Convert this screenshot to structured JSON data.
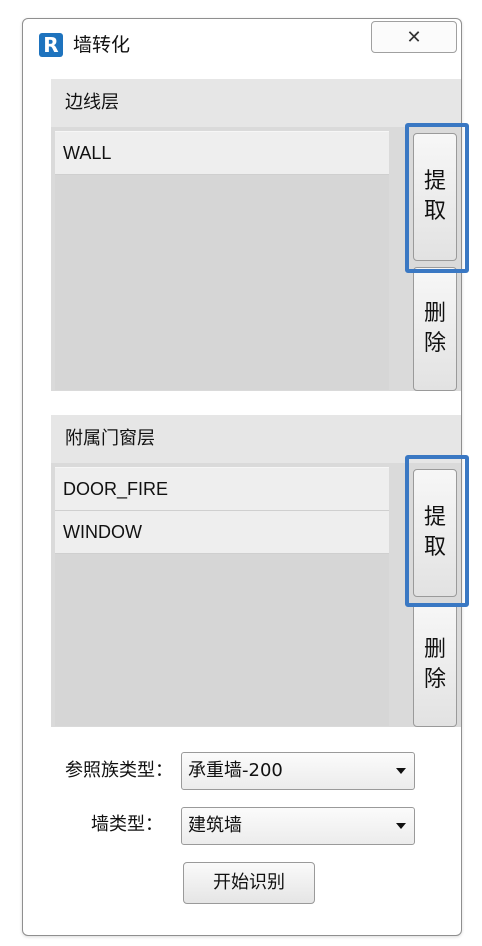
{
  "window": {
    "title": "墙转化",
    "app_icon_letter": "R",
    "close_symbol": "✕"
  },
  "edge_layer": {
    "label": "边线层",
    "items": [
      "WALL"
    ],
    "extract_button": [
      "提",
      "取"
    ],
    "delete_button": [
      "删",
      "除"
    ]
  },
  "opening_layer": {
    "label": "附属门窗层",
    "items": [
      "DOOR_FIRE",
      "WINDOW"
    ],
    "extract_button": [
      "提",
      "取"
    ],
    "delete_button": [
      "删",
      "除"
    ]
  },
  "form": {
    "ref_family_label": "参照族类型：",
    "ref_family_value": "承重墙-200",
    "wall_type_label": "墙类型：",
    "wall_type_value": "建筑墙",
    "start_button": "开始识别"
  },
  "colors": {
    "highlight": "#3a78c3",
    "app_icon": "#1e73be"
  }
}
